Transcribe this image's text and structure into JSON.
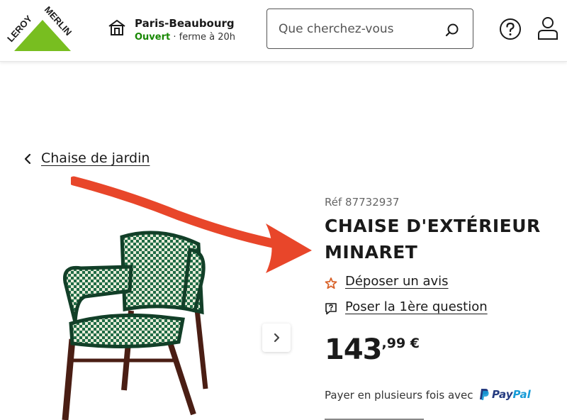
{
  "header": {
    "logo_text": "LEROY MERLIN",
    "store": {
      "name": "Paris-Beaubourg",
      "status_open": "Ouvert",
      "status_rest": " · ferme à 20h"
    },
    "search": {
      "placeholder": "Que cherchez-vous"
    },
    "icons": [
      "store-icon",
      "search-icon",
      "help-icon",
      "user-icon"
    ]
  },
  "breadcrumb": {
    "label": "Chaise de jardin"
  },
  "product": {
    "ref": "Réf 87732937",
    "title": "CHAISE D'EXTÉRIEUR MINARET",
    "review_label": "Déposer un avis",
    "question_label": "Poser la 1ère question",
    "price_int": "143",
    "price_dec": ",99 €",
    "payment_text": "Payer en plusieurs fois avec",
    "paypal_pay": "Pay",
    "paypal_pal": "Pal"
  },
  "colors": {
    "logo_green": "#78be20",
    "open_green": "#188803",
    "arrow_red": "#e8462a",
    "star": "#d9632b",
    "paypal_dark": "#253b80",
    "paypal_light": "#179bd7"
  }
}
